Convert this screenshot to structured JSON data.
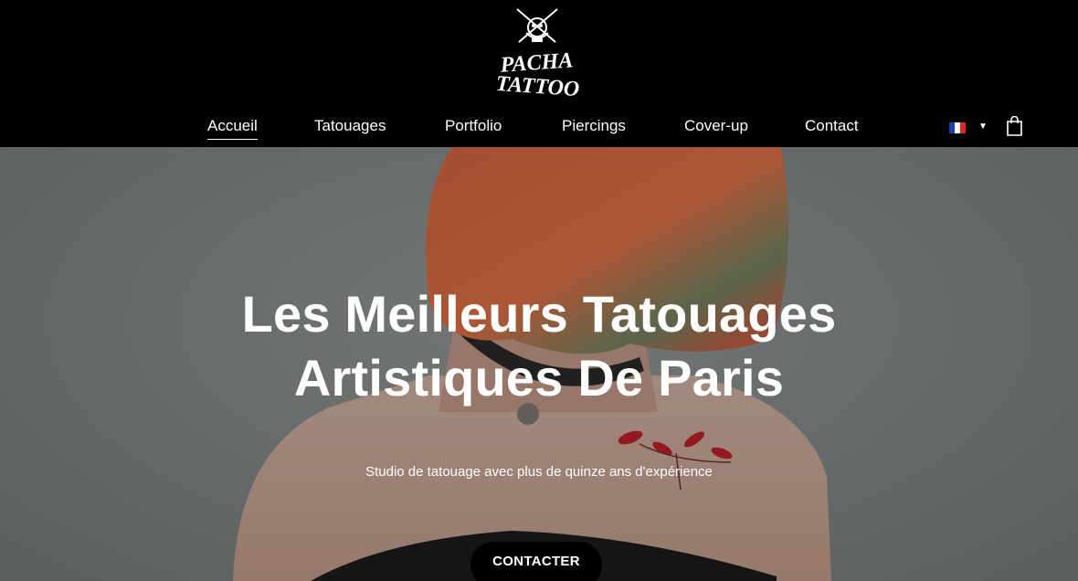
{
  "brand": {
    "logo_text_line1": "PACHA",
    "logo_text_line2": "TATTOO"
  },
  "nav": {
    "items": [
      {
        "label": "Accueil",
        "active": true
      },
      {
        "label": "Tatouages",
        "active": false
      },
      {
        "label": "Portfolio",
        "active": false
      },
      {
        "label": "Piercings",
        "active": false
      },
      {
        "label": "Cover-up",
        "active": false
      },
      {
        "label": "Contact",
        "active": false
      }
    ]
  },
  "language": {
    "current": "FR",
    "icon": "flag-france-icon",
    "dropdown_icon": "caret-down-icon"
  },
  "cart": {
    "icon": "shopping-bag-icon"
  },
  "hero": {
    "title_line1": "Les Meilleurs Tatouages",
    "title_line2": "Artistiques De Paris",
    "subtitle": "Studio de tatouage avec plus de quinze ans d'expérience",
    "cta_label": "CONTACTER"
  },
  "colors": {
    "header_bg": "#000000",
    "text": "#ffffff",
    "button_bg": "#000000",
    "flag_blue": "#1a3fa8",
    "flag_white": "#ffffff",
    "flag_red": "#e3242b"
  }
}
